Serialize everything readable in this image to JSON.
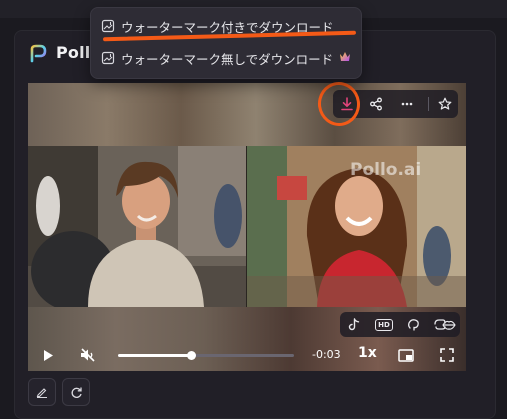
{
  "brand": {
    "name": "Pollo"
  },
  "video": {
    "watermark": "Pollo.ai",
    "current_time": "-0:03",
    "playback_speed": "1x",
    "progress_fraction": 0.42
  },
  "download_menu": {
    "items": [
      {
        "label": "ウォーターマーク付きでダウンロード",
        "icon": "image-download-icon",
        "badge": ""
      },
      {
        "label": "ウォーターマーク無しでダウンロード",
        "icon": "image-download-icon",
        "badge": "crown-icon"
      }
    ]
  },
  "action_bar": {
    "buttons": [
      "download-icon",
      "share-icon",
      "more-icon",
      "star-icon"
    ]
  },
  "feature_bar": {
    "buttons": [
      "tiktok-icon",
      "hd-icon",
      "lip-sync-icon",
      "swap-icon",
      "lips-icon"
    ],
    "hd_label": "HD"
  },
  "colors": {
    "accent": "#f45a17",
    "download_highlight": "#e1447a",
    "background": "#1b1a20"
  }
}
